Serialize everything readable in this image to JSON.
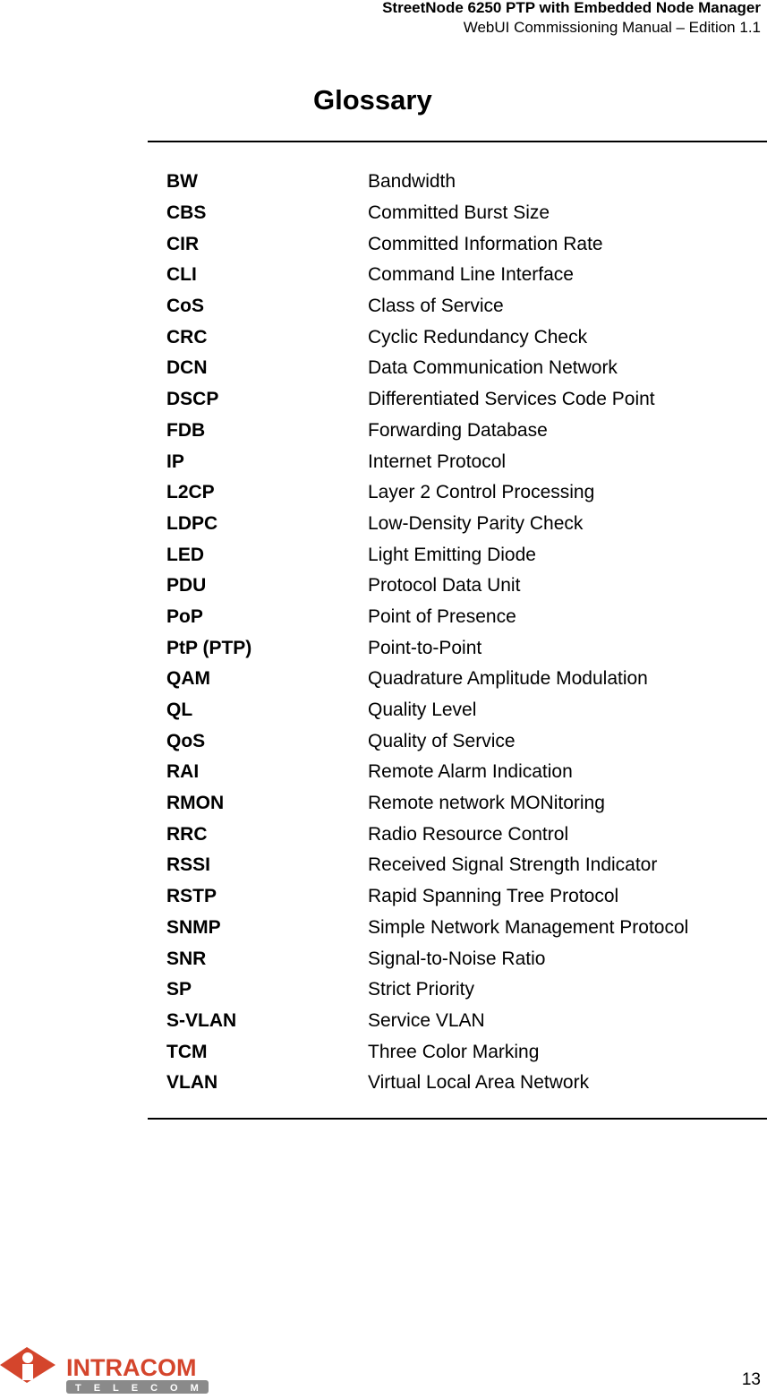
{
  "header": {
    "product": "StreetNode 6250 PTP with Embedded Node Manager",
    "manual": "WebUI Commissioning Manual – Edition 1.1"
  },
  "title": "Glossary",
  "entries": [
    {
      "abbr": "BW",
      "def": "Bandwidth"
    },
    {
      "abbr": "CBS",
      "def": "Committed Burst Size"
    },
    {
      "abbr": "CIR",
      "def": "Committed Information Rate"
    },
    {
      "abbr": "CLI",
      "def": "Command Line Interface"
    },
    {
      "abbr": "CoS",
      "def": "Class of Service"
    },
    {
      "abbr": "CRC",
      "def": "Cyclic Redundancy Check"
    },
    {
      "abbr": "DCN",
      "def": "Data Communication Network"
    },
    {
      "abbr": "DSCP",
      "def": "Differentiated Services Code Point"
    },
    {
      "abbr": "FDB",
      "def": "Forwarding Database"
    },
    {
      "abbr": "IP",
      "def": "Internet Protocol"
    },
    {
      "abbr": "L2CP",
      "def": "Layer 2 Control Processing"
    },
    {
      "abbr": "LDPC",
      "def": "Low-Density Parity Check"
    },
    {
      "abbr": "LED",
      "def": "Light Emitting Diode"
    },
    {
      "abbr": "PDU",
      "def": "Protocol Data Unit"
    },
    {
      "abbr": "PoP",
      "def": "Point of Presence"
    },
    {
      "abbr": "PtP (PTP)",
      "def": "Point-to-Point"
    },
    {
      "abbr": "QAM",
      "def": "Quadrature Amplitude Modulation"
    },
    {
      "abbr": "QL",
      "def": "Quality Level"
    },
    {
      "abbr": "QoS",
      "def": "Quality of Service"
    },
    {
      "abbr": "RAI",
      "def": "Remote Alarm Indication"
    },
    {
      "abbr": "RMON",
      "def": "Remote network MONitoring"
    },
    {
      "abbr": "RRC",
      "def": "Radio Resource Control"
    },
    {
      "abbr": "RSSI",
      "def": "Received Signal Strength Indicator"
    },
    {
      "abbr": "RSTP",
      "def": "Rapid Spanning Tree Protocol"
    },
    {
      "abbr": "SNMP",
      "def": "Simple Network Management Protocol"
    },
    {
      "abbr": "SNR",
      "def": "Signal-to-Noise Ratio"
    },
    {
      "abbr": "SP",
      "def": "Strict Priority"
    },
    {
      "abbr": "S-VLAN",
      "def": "Service VLAN"
    },
    {
      "abbr": "TCM",
      "def": "Three Color Marking"
    },
    {
      "abbr": "VLAN",
      "def": "Virtual Local Area Network"
    }
  ],
  "footer": {
    "logo": {
      "name": "INTRACOM",
      "sub": "TELECOM",
      "brand_color": "#d4452c",
      "sub_color": "#8a8a8a"
    },
    "page_number": "13"
  }
}
